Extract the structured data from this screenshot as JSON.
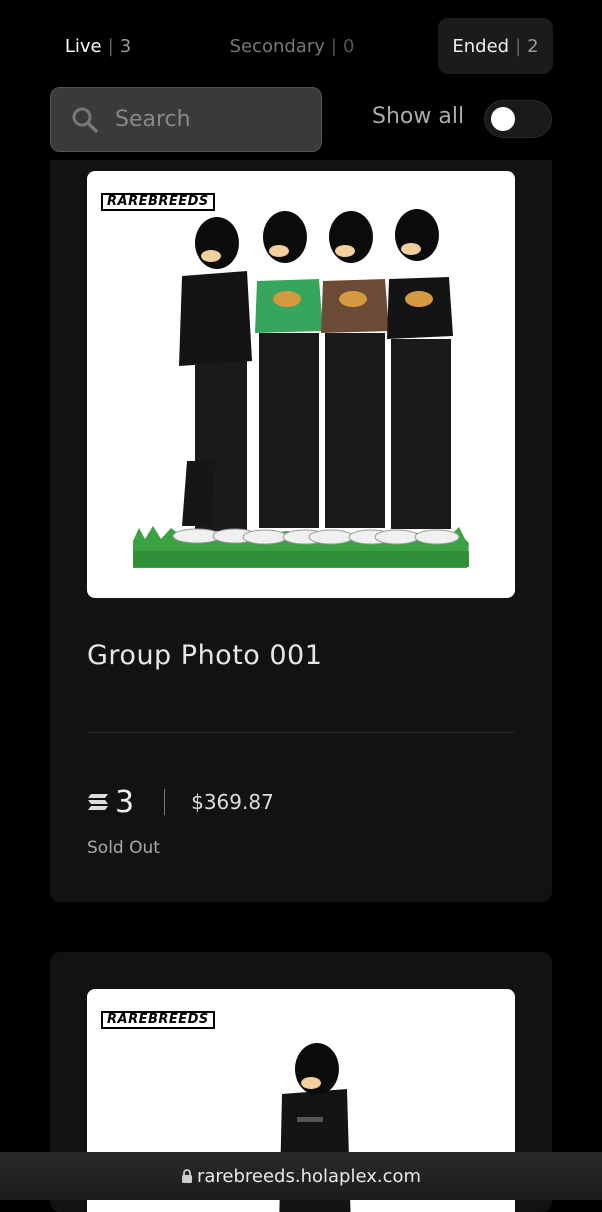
{
  "tabs": {
    "live": {
      "label": "Live",
      "count": "3"
    },
    "secondary": {
      "label": "Secondary",
      "count": "0"
    },
    "ended": {
      "label": "Ended",
      "count": "2"
    },
    "separator": "|"
  },
  "search": {
    "placeholder": "Search",
    "icon": "search-icon"
  },
  "show_all": {
    "label": "Show all",
    "enabled": false
  },
  "cards": [
    {
      "brand": "RAREBREEDS",
      "title": "Group Photo 001",
      "price_sol": "3",
      "price_usd": "$369.87",
      "status": "Sold Out",
      "currency_icon": "solana-icon"
    },
    {
      "brand": "RAREBREEDS"
    }
  ],
  "browser": {
    "url": "rarebreeds.holaplex.com",
    "icon": "lock-icon"
  }
}
